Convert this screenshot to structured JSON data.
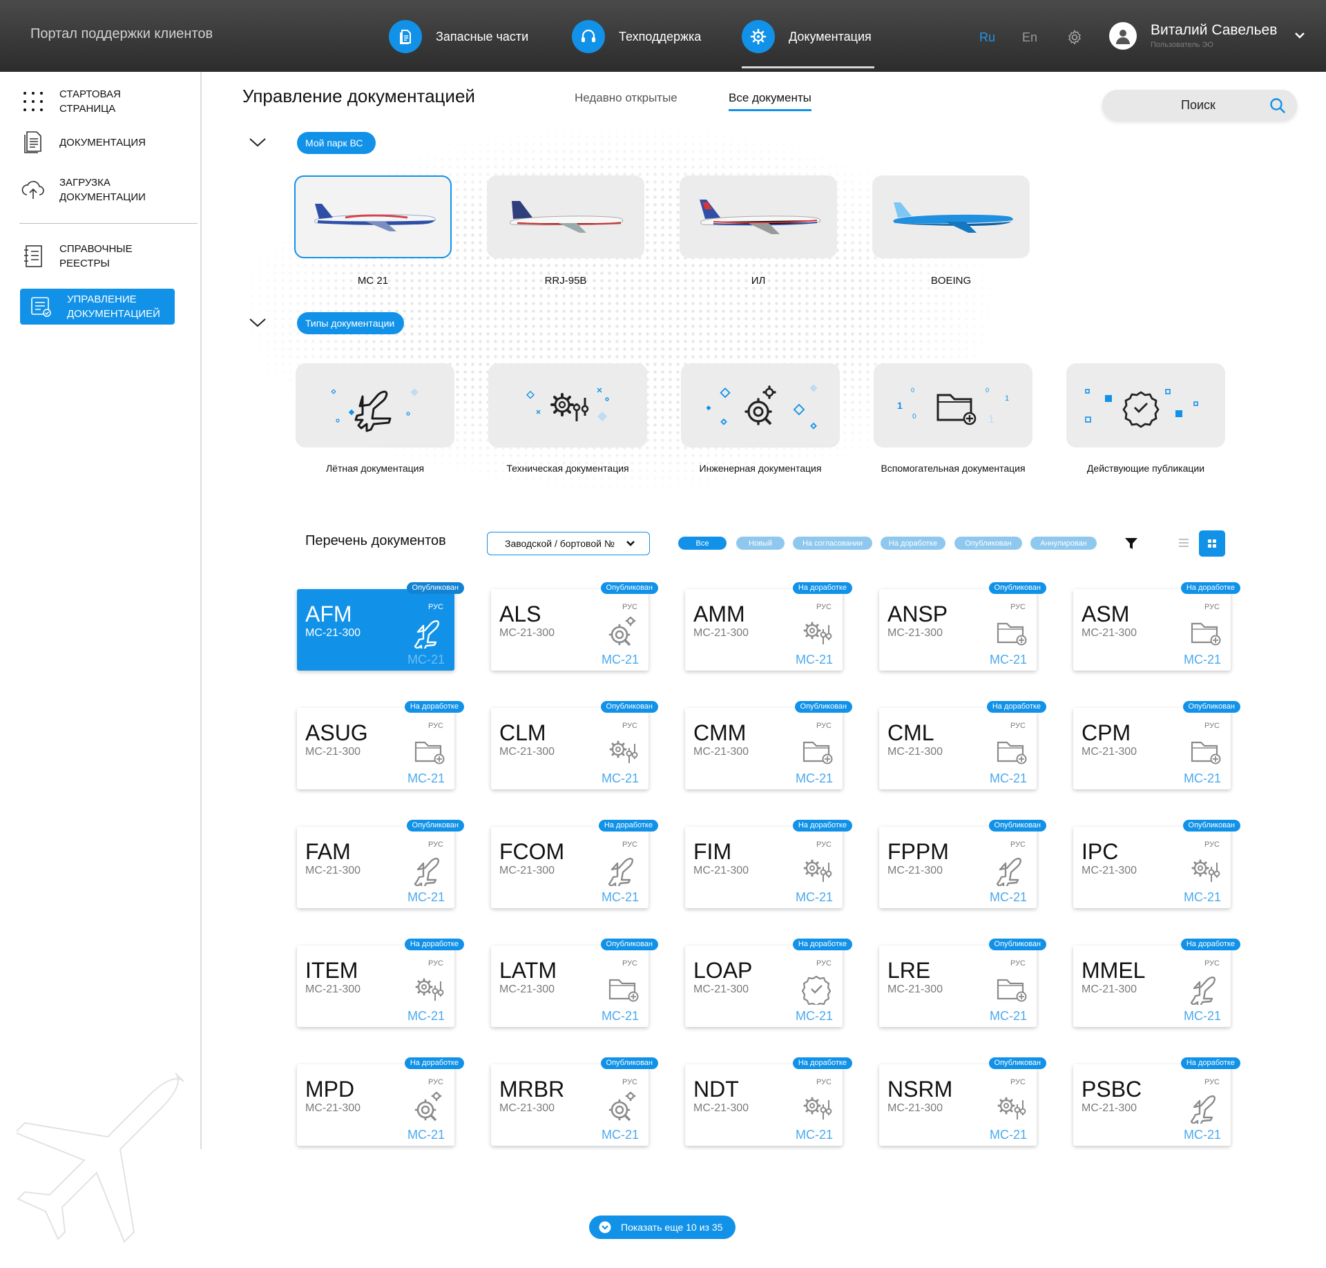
{
  "header": {
    "portal_title": "Портал поддержки клиентов",
    "nav": [
      {
        "label": "Запасные части",
        "icon": "document-icon"
      },
      {
        "label": "Техподдержка",
        "icon": "headset-icon"
      },
      {
        "label": "Документация",
        "icon": "gear-doc-icon"
      }
    ],
    "lang_ru": "Ru",
    "lang_en": "En",
    "user_name": "Виталий Савельев",
    "user_role": "Пользователь ЭО"
  },
  "sidebar": {
    "items": [
      {
        "label": "Стартовая страница",
        "icon": "grid-dots-icon"
      },
      {
        "label": "Документация",
        "icon": "document-list-icon"
      },
      {
        "label": "Загрузка документации",
        "icon": "cloud-upload-icon"
      },
      {
        "label": "Справочные реестры",
        "icon": "registry-icon"
      },
      {
        "label": "Управление документацией",
        "icon": "doc-manage-icon"
      }
    ]
  },
  "main": {
    "title": "Управление документацией",
    "tabs": {
      "recent": "Недавно открытые",
      "all": "Все документы"
    },
    "search_placeholder": "Поиск",
    "fleet_pill": "Мой парк ВС",
    "doc_types_pill": "Типы документации",
    "aircraft": [
      {
        "label": "МС 21"
      },
      {
        "label": "RRJ-95B"
      },
      {
        "label": "ИЛ"
      },
      {
        "label": "BOEING"
      }
    ],
    "doc_types": [
      {
        "label": "Лётная документация",
        "icon": "plane-icon"
      },
      {
        "label": "Техническая документация",
        "icon": "gears-sliders-icon"
      },
      {
        "label": "Инженерная документация",
        "icon": "gear-magnifier-icon"
      },
      {
        "label": "Вспомогательная документация",
        "icon": "folder-plus-icon"
      },
      {
        "label": "Действующие публикации",
        "icon": "check-badge-icon"
      }
    ],
    "list_title": "Перечень документов",
    "serial_select": "Заводской / бортовой №",
    "filters": [
      "Все",
      "Новый",
      "На согласовании",
      "На доработке",
      "Опубликован",
      "Аннулирован"
    ],
    "show_more": "Показать еще 10 из 35"
  },
  "documents": [
    {
      "code": "AFM",
      "model": "МС-21-300",
      "lang": "РУС",
      "fleet": "МС-21",
      "status": "Опубликован",
      "icon": "plane"
    },
    {
      "code": "ALS",
      "model": "МС-21-300",
      "lang": "РУС",
      "fleet": "МС-21",
      "status": "Опубликован",
      "icon": "gearmag"
    },
    {
      "code": "AMM",
      "model": "МС-21-300",
      "lang": "РУС",
      "fleet": "МС-21",
      "status": "На доработке",
      "icon": "gears"
    },
    {
      "code": "ANSP",
      "model": "МС-21-300",
      "lang": "РУС",
      "fleet": "МС-21",
      "status": "Опубликован",
      "icon": "folder"
    },
    {
      "code": "ASM",
      "model": "МС-21-300",
      "lang": "РУС",
      "fleet": "МС-21",
      "status": "На доработке",
      "icon": "folder"
    },
    {
      "code": "ASUG",
      "model": "МС-21-300",
      "lang": "РУС",
      "fleet": "МС-21",
      "status": "На доработке",
      "icon": "folder"
    },
    {
      "code": "CLM",
      "model": "МС-21-300",
      "lang": "РУС",
      "fleet": "МС-21",
      "status": "Опубликован",
      "icon": "gears"
    },
    {
      "code": "CMM",
      "model": "МС-21-300",
      "lang": "РУС",
      "fleet": "МС-21",
      "status": "Опубликован",
      "icon": "folder"
    },
    {
      "code": "CML",
      "model": "МС-21-300",
      "lang": "РУС",
      "fleet": "МС-21",
      "status": "На доработке",
      "icon": "folder"
    },
    {
      "code": "CPM",
      "model": "МС-21-300",
      "lang": "РУС",
      "fleet": "МС-21",
      "status": "Опубликован",
      "icon": "folder"
    },
    {
      "code": "FAM",
      "model": "МС-21-300",
      "lang": "РУС",
      "fleet": "МС-21",
      "status": "Опубликован",
      "icon": "plane"
    },
    {
      "code": "FCOM",
      "model": "МС-21-300",
      "lang": "РУС",
      "fleet": "МС-21",
      "status": "На доработке",
      "icon": "plane"
    },
    {
      "code": "FIM",
      "model": "МС-21-300",
      "lang": "РУС",
      "fleet": "МС-21",
      "status": "На доработке",
      "icon": "gears"
    },
    {
      "code": "FPPM",
      "model": "МС-21-300",
      "lang": "РУС",
      "fleet": "МС-21",
      "status": "Опубликован",
      "icon": "plane"
    },
    {
      "code": "IPC",
      "model": "МС-21-300",
      "lang": "РУС",
      "fleet": "МС-21",
      "status": "Опубликован",
      "icon": "gears"
    },
    {
      "code": "ITEM",
      "model": "МС-21-300",
      "lang": "РУС",
      "fleet": "МС-21",
      "status": "На доработке",
      "icon": "gears"
    },
    {
      "code": "LATM",
      "model": "МС-21-300",
      "lang": "РУС",
      "fleet": "МС-21",
      "status": "Опубликован",
      "icon": "folder"
    },
    {
      "code": "LOAP",
      "model": "МС-21-300",
      "lang": "РУС",
      "fleet": "МС-21",
      "status": "На доработке",
      "icon": "check"
    },
    {
      "code": "LRE",
      "model": "МС-21-300",
      "lang": "РУС",
      "fleet": "МС-21",
      "status": "Опубликован",
      "icon": "folder"
    },
    {
      "code": "MMEL",
      "model": "МС-21-300",
      "lang": "РУС",
      "fleet": "МС-21",
      "status": "На доработке",
      "icon": "plane"
    },
    {
      "code": "MPD",
      "model": "МС-21-300",
      "lang": "РУС",
      "fleet": "МС-21",
      "status": "На доработке",
      "icon": "gearmag"
    },
    {
      "code": "MRBR",
      "model": "МС-21-300",
      "lang": "РУС",
      "fleet": "МС-21",
      "status": "Опубликован",
      "icon": "gearmag"
    },
    {
      "code": "NDT",
      "model": "МС-21-300",
      "lang": "РУС",
      "fleet": "МС-21",
      "status": "На доработке",
      "icon": "gears"
    },
    {
      "code": "NSRM",
      "model": "МС-21-300",
      "lang": "РУС",
      "fleet": "МС-21",
      "status": "Опубликован",
      "icon": "gears"
    },
    {
      "code": "PSBC",
      "model": "МС-21-300",
      "lang": "РУС",
      "fleet": "МС-21",
      "status": "На доработке",
      "icon": "plane"
    }
  ],
  "colors": {
    "accent": "#1192e8",
    "accent_light": "#8fc8ee",
    "header_dark": "#2c2c2c"
  }
}
